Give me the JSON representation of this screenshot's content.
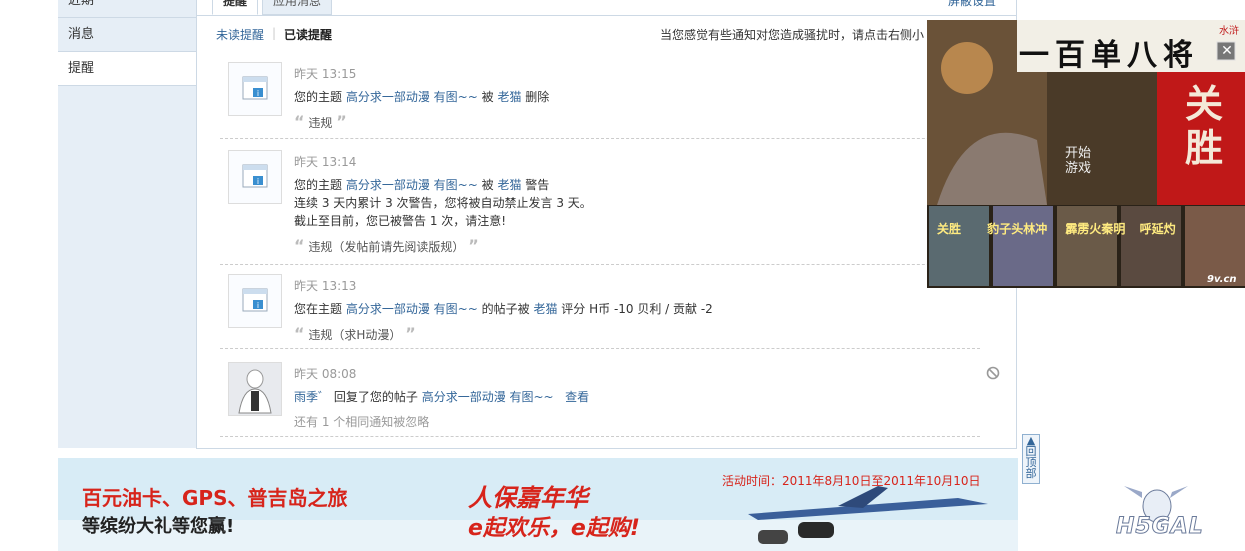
{
  "sidebar": {
    "items": [
      {
        "label": "近期"
      },
      {
        "label": "消息"
      },
      {
        "label": "提醒"
      }
    ]
  },
  "tabs": [
    {
      "label": "提醒"
    },
    {
      "label": "应用消息"
    }
  ],
  "top_right_link": "屏蔽设置",
  "subnav": {
    "unread": "未读提醒",
    "read": "已读提醒"
  },
  "notice_text": "当您感觉有些通知对您造成骚扰时，请点击右侧小",
  "notifications": [
    {
      "time": "昨天 13:15",
      "prefix": "您的主题",
      "topic": "高分求一部动漫 有图~~",
      "by": "被",
      "user": "老猫",
      "action": "删除",
      "reason": "违规"
    },
    {
      "time": "昨天 13:14",
      "prefix": "您的主题",
      "topic": "高分求一部动漫 有图~~",
      "by": "被",
      "user": "老猫",
      "action": "警告",
      "line2": "连续 3 天内累计 3 次警告，您将被自动禁止发言 3 天。",
      "line3": "截止至目前，您已被警告 1 次，请注意!",
      "reason": "违规（发帖前请先阅读版规）"
    },
    {
      "time": "昨天 13:13",
      "prefix": "您在主题",
      "topic": "高分求一部动漫 有图~~",
      "mid": "的帖子被",
      "user": "老猫",
      "action": "评分 H币 -10 贝利 / 贡献 -2",
      "reason": "违规（求H动漫）"
    },
    {
      "time": "昨天 08:08",
      "user": "雨季゛",
      "mid": "回复了您的帖子",
      "topic": "高分求一部动漫 有图~~",
      "view": "查看",
      "ignored": "还有 1 个相同通知被忽略"
    }
  ],
  "ad_right": {
    "title": "一百单八将",
    "badge": "水浒",
    "hero": "关胜",
    "start_text": "开始游戏",
    "cards": [
      "关胜",
      "豹子头林冲",
      "霹雳火秦明",
      "呼延灼"
    ],
    "site": "9v.cn"
  },
  "banner": {
    "line1": "百元油卡、GPS、普吉岛之旅",
    "line2": "等缤纷大礼等您赢!",
    "brand": "人保嘉年华",
    "slogan": "e起欢乐，e起购!",
    "date": "活动时间：2011年8月10日至2011年10月10日"
  },
  "back_to_top": "回顶部",
  "logo": "H5GAL",
  "colors": {
    "link": "#336699",
    "sidebar_bg": "#e6eef6",
    "border": "#cdd9e5",
    "banner_red": "#d7241b"
  }
}
